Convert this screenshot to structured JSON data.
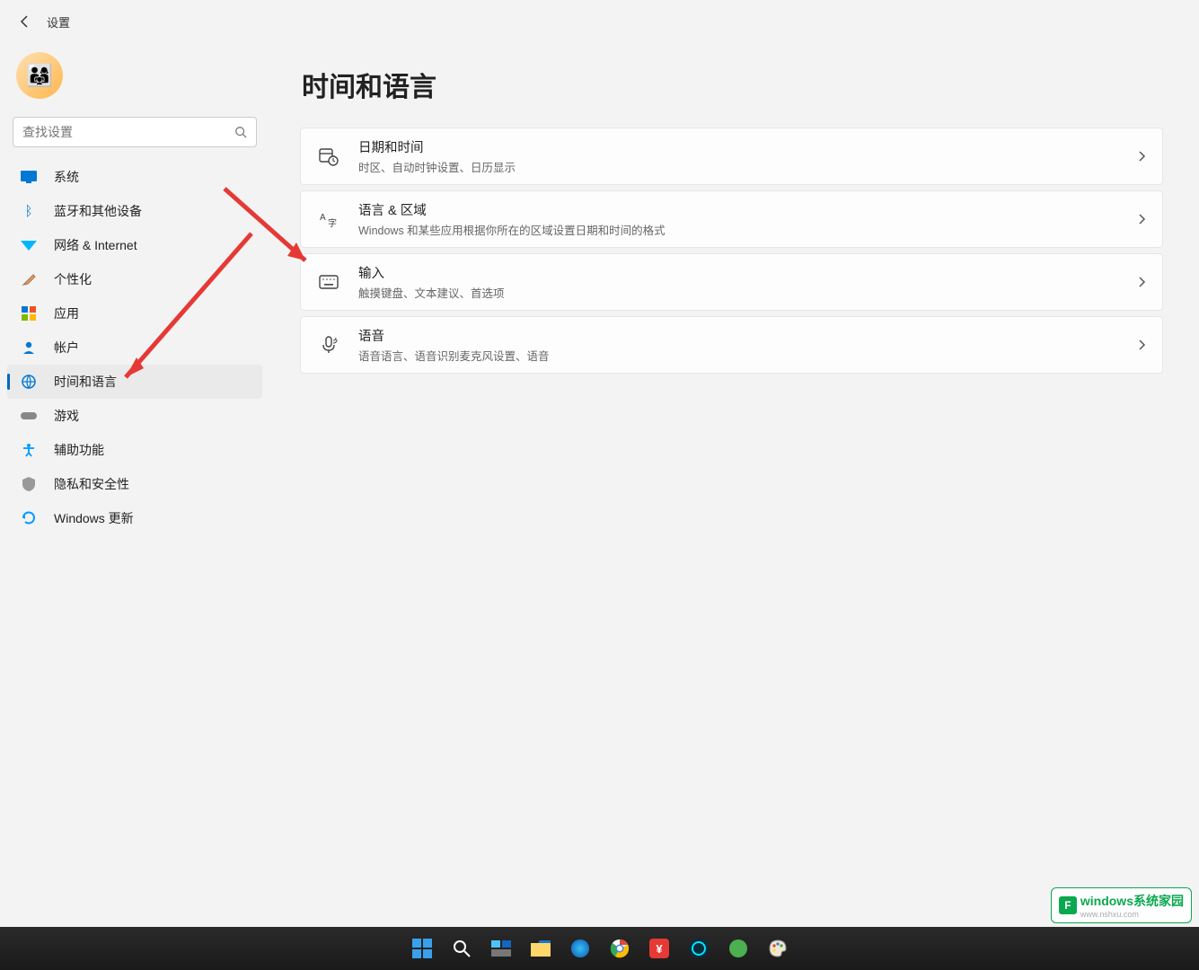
{
  "header": {
    "title": "设置"
  },
  "search": {
    "placeholder": "查找设置"
  },
  "sidebar": {
    "items": [
      {
        "id": "system",
        "label": "系统",
        "icon": "monitor",
        "color": "#0078d4"
      },
      {
        "id": "bluetooth",
        "label": "蓝牙和其他设备",
        "icon": "bluetooth",
        "color": "#0078d4"
      },
      {
        "id": "network",
        "label": "网络 & Internet",
        "icon": "wifi",
        "color": "#00b7ff"
      },
      {
        "id": "personalization",
        "label": "个性化",
        "icon": "brush",
        "color": "#e67e22"
      },
      {
        "id": "apps",
        "label": "应用",
        "icon": "apps",
        "color": "#0078d4"
      },
      {
        "id": "accounts",
        "label": "帐户",
        "icon": "person",
        "color": "#0078d4"
      },
      {
        "id": "time-language",
        "label": "时间和语言",
        "icon": "globe-clock",
        "color": "#0078d4",
        "active": true
      },
      {
        "id": "gaming",
        "label": "游戏",
        "icon": "game",
        "color": "#888"
      },
      {
        "id": "accessibility",
        "label": "辅助功能",
        "icon": "accessibility",
        "color": "#0099ff"
      },
      {
        "id": "privacy",
        "label": "隐私和安全性",
        "icon": "shield",
        "color": "#888"
      },
      {
        "id": "update",
        "label": "Windows 更新",
        "icon": "update",
        "color": "#0099ff"
      }
    ]
  },
  "main": {
    "title": "时间和语言",
    "cards": [
      {
        "id": "date-time",
        "title": "日期和时间",
        "desc": "时区、自动时钟设置、日历显示",
        "icon": "calendar-clock"
      },
      {
        "id": "language-region",
        "title": "语言 & 区域",
        "desc": "Windows 和某些应用根据你所在的区域设置日期和时间的格式",
        "icon": "language"
      },
      {
        "id": "typing",
        "title": "输入",
        "desc": "触摸键盘、文本建议、首选项",
        "icon": "keyboard"
      },
      {
        "id": "speech",
        "title": "语音",
        "desc": "语音语言、语音识别麦克风设置、语音",
        "icon": "mic"
      }
    ]
  },
  "taskbar": {
    "items": [
      {
        "id": "start",
        "icon": "windows"
      },
      {
        "id": "search",
        "icon": "search"
      },
      {
        "id": "taskview",
        "icon": "taskview"
      },
      {
        "id": "explorer",
        "icon": "folder"
      },
      {
        "id": "edge",
        "icon": "edge"
      },
      {
        "id": "chrome",
        "icon": "chrome"
      },
      {
        "id": "app-red",
        "icon": "red"
      },
      {
        "id": "app-cyan",
        "icon": "cyan"
      },
      {
        "id": "app-green",
        "icon": "green"
      },
      {
        "id": "paint",
        "icon": "paint"
      }
    ]
  },
  "watermark": {
    "brand_zh": "windows系统家园",
    "url": "www.nshxu.com"
  }
}
